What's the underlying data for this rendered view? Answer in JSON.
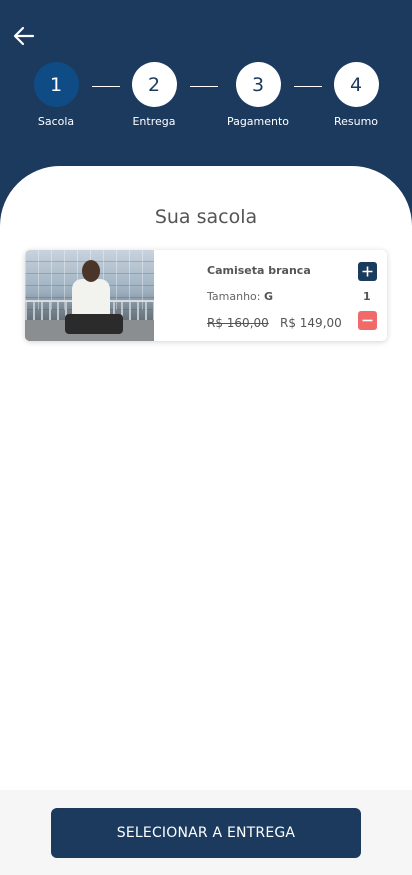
{
  "header": {
    "back_icon": "arrow-left-icon",
    "steps": [
      {
        "number": "1",
        "label": "Sacola",
        "active": true
      },
      {
        "number": "2",
        "label": "Entrega",
        "active": false
      },
      {
        "number": "3",
        "label": "Pagamento",
        "active": false
      },
      {
        "number": "4",
        "label": "Resumo",
        "active": false
      }
    ]
  },
  "main": {
    "title": "Sua sacola",
    "items": [
      {
        "name": "Camiseta branca",
        "size_label": "Tamanho:",
        "size_value": "G",
        "quantity": "1",
        "old_price": "R$ 160,00",
        "price": "R$ 149,00",
        "image_alt": "person wearing white t-shirt sitting on ledge"
      }
    ]
  },
  "footer": {
    "cta_label": "SELECIONAR A ENTREGA"
  },
  "colors": {
    "primary": "#1b3a5e",
    "active_step": "#0f4c86",
    "danger": "#f16a6a",
    "background": "#ffffff"
  }
}
